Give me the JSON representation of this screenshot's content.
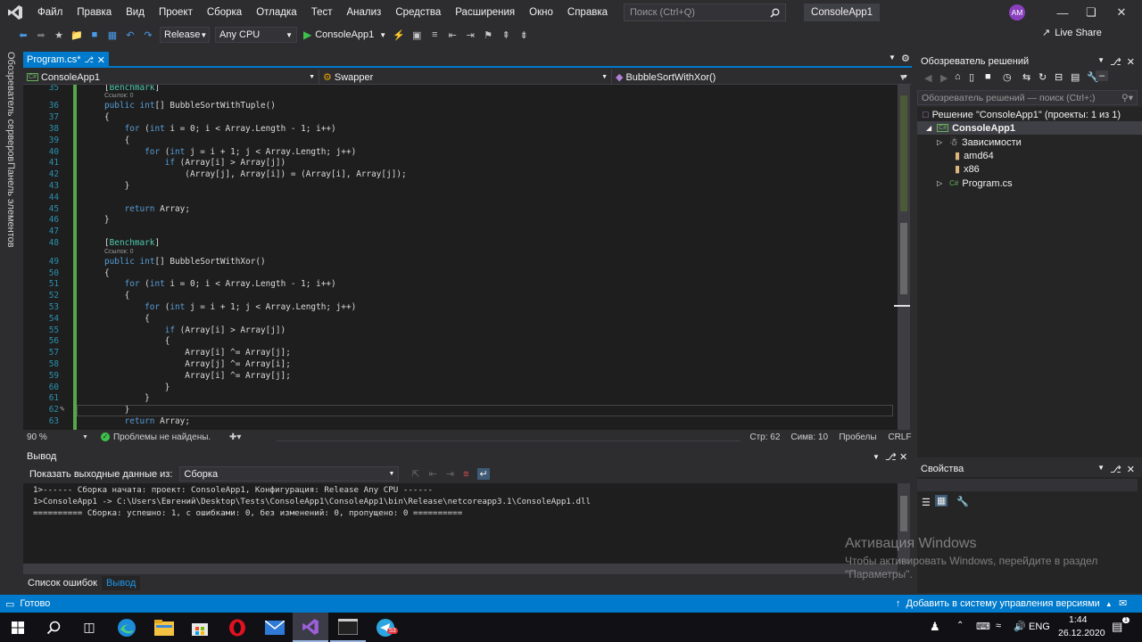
{
  "menu": {
    "items": [
      "Файл",
      "Правка",
      "Вид",
      "Проект",
      "Сборка",
      "Отладка",
      "Тест",
      "Анализ",
      "Средства",
      "Расширения",
      "Окно",
      "Справка"
    ],
    "search_placeholder": "Поиск (Ctrl+Q)",
    "solution_title": "ConsoleApp1",
    "avatar_initials": "AM"
  },
  "toolbar": {
    "configuration": "Release",
    "platform": "Any CPU",
    "run_target": "ConsoleApp1",
    "live_share": "Live Share"
  },
  "side_tabs": [
    "Обозреватель серверов",
    "Панель элементов"
  ],
  "editor_tab": {
    "label": "Program.cs*"
  },
  "navbar": {
    "project": "ConsoleApp1",
    "class": "Swapper",
    "member": "BubbleSortWithXor()"
  },
  "code": {
    "codelens": "Ссылок: 0",
    "lines": [
      {
        "n": "35",
        "t": "[Benchmark]"
      },
      {
        "n": "36",
        "t": "public int[] BubbleSortWithTuple()"
      },
      {
        "n": "37",
        "t": "{"
      },
      {
        "n": "38",
        "t": "    for (int i = 0; i < Array.Length - 1; i++)"
      },
      {
        "n": "39",
        "t": "    {"
      },
      {
        "n": "40",
        "t": "        for (int j = i + 1; j < Array.Length; j++)"
      },
      {
        "n": "41",
        "t": "            if (Array[i] > Array[j])"
      },
      {
        "n": "42",
        "t": "                (Array[j], Array[i]) = (Array[i], Array[j]);"
      },
      {
        "n": "43",
        "t": "    }"
      },
      {
        "n": "44",
        "t": ""
      },
      {
        "n": "45",
        "t": "    return Array;"
      },
      {
        "n": "46",
        "t": "}"
      },
      {
        "n": "47",
        "t": ""
      },
      {
        "n": "48",
        "t": "[Benchmark]"
      },
      {
        "n": "49",
        "t": "public int[] BubbleSortWithXor()"
      },
      {
        "n": "50",
        "t": "{"
      },
      {
        "n": "51",
        "t": "    for (int i = 0; i < Array.Length - 1; i++)"
      },
      {
        "n": "52",
        "t": "    {"
      },
      {
        "n": "53",
        "t": "        for (int j = i + 1; j < Array.Length; j++)"
      },
      {
        "n": "54",
        "t": "        {"
      },
      {
        "n": "55",
        "t": "            if (Array[i] > Array[j])"
      },
      {
        "n": "56",
        "t": "            {"
      },
      {
        "n": "57",
        "t": "                Array[i] ^= Array[j];"
      },
      {
        "n": "58",
        "t": "                Array[j] ^= Array[i];"
      },
      {
        "n": "59",
        "t": "                Array[i] ^= Array[j];"
      },
      {
        "n": "60",
        "t": "            }"
      },
      {
        "n": "61",
        "t": "        }"
      },
      {
        "n": "62",
        "t": "    }"
      },
      {
        "n": "63",
        "t": "    return Array;"
      }
    ]
  },
  "editor_status": {
    "zoom": "90 %",
    "issues": "Проблемы не найдены.",
    "line": "Стр: 62",
    "col": "Симв: 10",
    "spaces": "Пробелы",
    "eol": "CRLF"
  },
  "output": {
    "title": "Вывод",
    "show_from_label": "Показать выходные данные из:",
    "source": "Сборка",
    "lines": [
      "1>------ Сборка начата: проект: ConsoleApp1, Конфигурация: Release Any CPU ------",
      "1>ConsoleApp1 -> C:\\Users\\Евгений\\Desktop\\Tests\\ConsoleApp1\\ConsoleApp1\\bin\\Release\\netcoreapp3.1\\ConsoleApp1.dll",
      "========== Сборка: успешно: 1, с ошибками: 0, без изменений: 0, пропущено: 0 =========="
    ]
  },
  "bottom_tabs": [
    "Список ошибок",
    "Вывод"
  ],
  "solution_explorer": {
    "title": "Обозреватель решений",
    "search_placeholder": "Обозреватель решений — поиск (Ctrl+;)",
    "solution": "Решение \"ConsoleApp1\" (проекты: 1 из 1)",
    "project": "ConsoleApp1",
    "items": [
      "Зависимости",
      "amd64",
      "x86",
      "Program.cs"
    ]
  },
  "properties": {
    "title": "Свойства"
  },
  "statusbar": {
    "ready": "Готово",
    "source_control": "Добавить в систему управления версиями"
  },
  "watermark": {
    "title": "Активация Windows",
    "sub1": "Чтобы активировать Windows, перейдите в раздел",
    "sub2": "\"Параметры\"."
  },
  "taskbar": {
    "lang": "ENG",
    "time": "1:44",
    "date": "26.12.2020",
    "telegram_badge": "53",
    "notifications": "1"
  },
  "colors": {
    "accent": "#007acc",
    "vs_purple": "#68217a",
    "keyword": "#569cd6",
    "type": "#4ec9b0",
    "line_number": "#2b91af"
  }
}
